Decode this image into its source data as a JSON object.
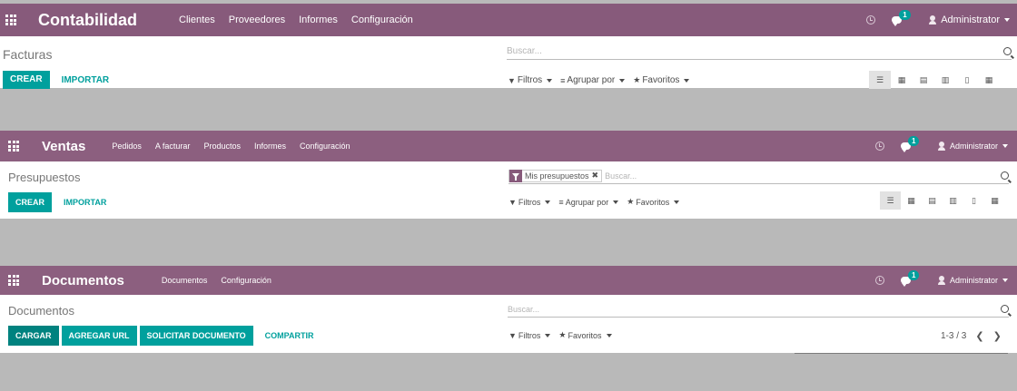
{
  "theme": {
    "navbar": "#875a7b",
    "navbar_faded": "#8c5f7f",
    "accent": "#00a09d",
    "background": "#b9b9b9"
  },
  "apps": [
    {
      "id": "contabilidad",
      "title": "Contabilidad",
      "menu": [
        "Clientes",
        "Proveedores",
        "Informes",
        "Configuración"
      ],
      "chat_count": "1",
      "user": "Administrator",
      "breadcrumb": "Facturas",
      "buttons": [
        "CREAR"
      ],
      "links": [
        "IMPORTAR"
      ],
      "search_placeholder": "Buscar...",
      "filters": [
        "Filtros",
        "Agrupar por",
        "Favoritos"
      ],
      "views": [
        "list-view",
        "kanban-view",
        "calendar-view",
        "pivot-view",
        "graph-view",
        "grid-view"
      ]
    },
    {
      "id": "ventas",
      "title": "Ventas",
      "menu": [
        "Pedidos",
        "A facturar",
        "Productos",
        "Informes",
        "Configuración"
      ],
      "chat_count": "1",
      "user": "Administrator",
      "breadcrumb": "Presupuestos",
      "buttons": [
        "CREAR"
      ],
      "links": [
        "IMPORTAR"
      ],
      "facet": "Mis presupuestos",
      "search_placeholder": "Buscar...",
      "filters": [
        "Filtros",
        "Agrupar por",
        "Favoritos"
      ],
      "views": [
        "list-view",
        "kanban-view",
        "calendar-view",
        "pivot-view",
        "graph-view",
        "grid-view"
      ]
    },
    {
      "id": "documentos",
      "title": "Documentos",
      "menu": [
        "Documentos",
        "Configuración"
      ],
      "chat_count": "1",
      "user": "Administrator",
      "breadcrumb": "Documentos",
      "buttons": [
        "CARGAR",
        "AGREGAR URL",
        "SOLICITAR DOCUMENTO"
      ],
      "links": [
        "COMPARTIR"
      ],
      "search_placeholder": "Buscar...",
      "filters": [
        "Filtros",
        "Favoritos"
      ],
      "pager": "1-3 / 3"
    }
  ]
}
